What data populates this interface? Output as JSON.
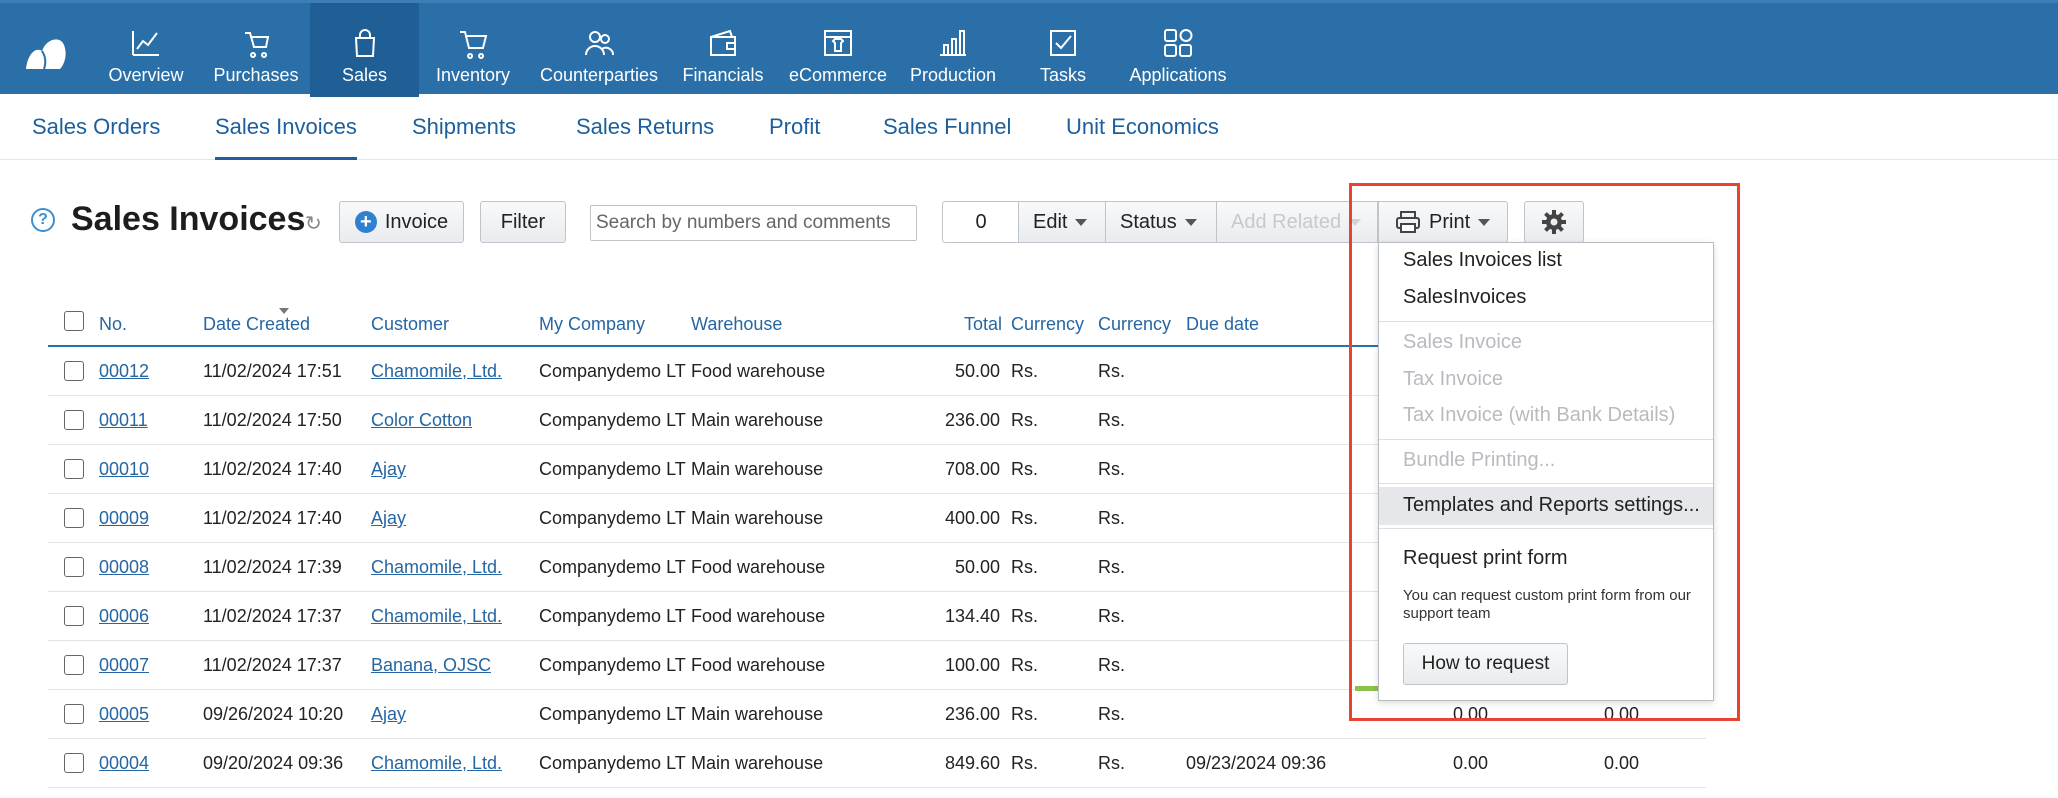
{
  "nav": {
    "items": [
      {
        "label": "Overview",
        "icon": "chart-line-icon"
      },
      {
        "label": "Purchases",
        "icon": "cart-hand-icon"
      },
      {
        "label": "Sales",
        "icon": "shopping-bag-icon"
      },
      {
        "label": "Inventory",
        "icon": "shopping-cart-icon"
      },
      {
        "label": "Counterparties",
        "icon": "people-icon"
      },
      {
        "label": "Financials",
        "icon": "wallet-icon"
      },
      {
        "label": "eCommerce",
        "icon": "storefront-icon"
      },
      {
        "label": "Production",
        "icon": "factory-icon"
      },
      {
        "label": "Tasks",
        "icon": "checkbox-icon"
      },
      {
        "label": "Applications",
        "icon": "apps-grid-icon"
      }
    ],
    "active": "Sales",
    "color": "#2a6fa8"
  },
  "subnav": {
    "items": [
      "Sales Orders",
      "Sales Invoices",
      "Shipments",
      "Sales Returns",
      "Profit",
      "Sales Funnel",
      "Unit Economics"
    ],
    "active": "Sales Invoices"
  },
  "toolbar": {
    "title": "Sales Invoices",
    "help": "?",
    "invoice_label": "Invoice",
    "filter_label": "Filter",
    "search_placeholder": "Search by numbers and comments",
    "selected_count": "0",
    "edit_label": "Edit",
    "status_label": "Status",
    "add_related_label": "Add Related",
    "print_label": "Print"
  },
  "table": {
    "headers": {
      "no": "No.",
      "date": "Date Created",
      "customer": "Customer",
      "company": "My Company",
      "warehouse": "Warehouse",
      "total": "Total",
      "currency1": "Currency",
      "currency2": "Currency",
      "due": "Due date"
    },
    "rows": [
      {
        "no": "00012",
        "date": "11/02/2024 17:51",
        "customer": "Chamomile, Ltd.",
        "company": "Companydemo LTD",
        "warehouse": "Food warehouse",
        "total": "50.00",
        "cur1": "Rs.",
        "cur2": "Rs.",
        "due": "",
        "c1": "",
        "c2": ""
      },
      {
        "no": "00011",
        "date": "11/02/2024 17:50",
        "customer": "Color Cotton",
        "company": "Companydemo LTD",
        "warehouse": "Main warehouse",
        "total": "236.00",
        "cur1": "Rs.",
        "cur2": "Rs.",
        "due": "",
        "c1": "",
        "c2": ""
      },
      {
        "no": "00010",
        "date": "11/02/2024 17:40",
        "customer": "Ajay",
        "company": "Companydemo LTD",
        "warehouse": "Main warehouse",
        "total": "708.00",
        "cur1": "Rs.",
        "cur2": "Rs.",
        "due": "",
        "c1": "",
        "c2": ""
      },
      {
        "no": "00009",
        "date": "11/02/2024 17:40",
        "customer": "Ajay",
        "company": "Companydemo LTD",
        "warehouse": "Main warehouse",
        "total": "400.00",
        "cur1": "Rs.",
        "cur2": "Rs.",
        "due": "",
        "c1": "",
        "c2": ""
      },
      {
        "no": "00008",
        "date": "11/02/2024 17:39",
        "customer": "Chamomile, Ltd.",
        "company": "Companydemo LTD",
        "warehouse": "Food warehouse",
        "total": "50.00",
        "cur1": "Rs.",
        "cur2": "Rs.",
        "due": "",
        "c1": "",
        "c2": ""
      },
      {
        "no": "00006",
        "date": "11/02/2024 17:37",
        "customer": "Chamomile, Ltd.",
        "company": "Companydemo LTD",
        "warehouse": "Food warehouse",
        "total": "134.40",
        "cur1": "Rs.",
        "cur2": "Rs.",
        "due": "",
        "c1": "",
        "c2": ""
      },
      {
        "no": "00007",
        "date": "11/02/2024 17:37",
        "customer": "Banana, OJSC",
        "company": "Companydemo LTD",
        "warehouse": "Food warehouse",
        "total": "100.00",
        "cur1": "Rs.",
        "cur2": "Rs.",
        "due": "",
        "c1": "",
        "c2": ""
      },
      {
        "no": "00005",
        "date": "09/26/2024 10:20",
        "customer": "Ajay",
        "company": "Companydemo LTD",
        "warehouse": "Main warehouse",
        "total": "236.00",
        "cur1": "Rs.",
        "cur2": "Rs.",
        "due": "",
        "c1": "0.00",
        "c2": "0.00"
      },
      {
        "no": "00004",
        "date": "09/20/2024 09:36",
        "customer": "Chamomile, Ltd.",
        "company": "Companydemo LTD",
        "warehouse": "Main warehouse",
        "total": "849.60",
        "cur1": "Rs.",
        "cur2": "Rs.",
        "due": "09/23/2024 09:36",
        "c1": "0.00",
        "c2": "0.00"
      }
    ]
  },
  "print_menu": {
    "item1": "Sales Invoices list",
    "item2": "SalesInvoices",
    "item3": "Sales Invoice",
    "item4": "Tax Invoice",
    "item5": "Tax Invoice (with Bank Details)",
    "item6": "Bundle Printing...",
    "item7": "Templates and Reports settings...",
    "request_title": "Request print form",
    "request_note": "You can request custom print form from our support team",
    "request_button": "How to request"
  },
  "colors": {
    "accent": "#2a6fa8",
    "link": "#2666a3",
    "highlight": "#e8432f"
  }
}
